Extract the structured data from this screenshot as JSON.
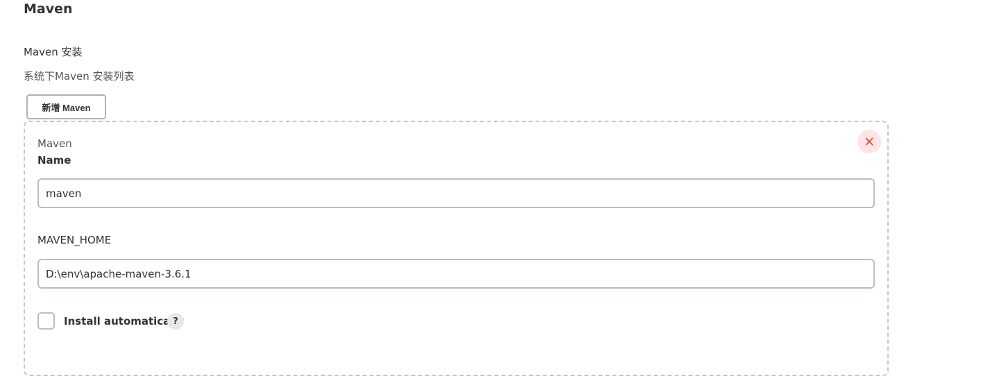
{
  "section": {
    "title": "Maven"
  },
  "installations": {
    "label": "Maven 安装",
    "description": "系统下Maven 安装列表",
    "add_button_label": "新增 Maven"
  },
  "installation_card": {
    "kind": "Maven",
    "name_label": "Name",
    "name_value": "maven",
    "home_label": "MAVEN_HOME",
    "home_value": "D:\\env\\apache-maven-3.6.1",
    "install_auto_label": "Install automatically",
    "install_auto_checked": false,
    "help_symbol": "?"
  },
  "icons": {
    "close": "close-icon",
    "help": "help-icon"
  },
  "colors": {
    "close_icon": "#d24939",
    "close_bg": "#fde4e6"
  }
}
